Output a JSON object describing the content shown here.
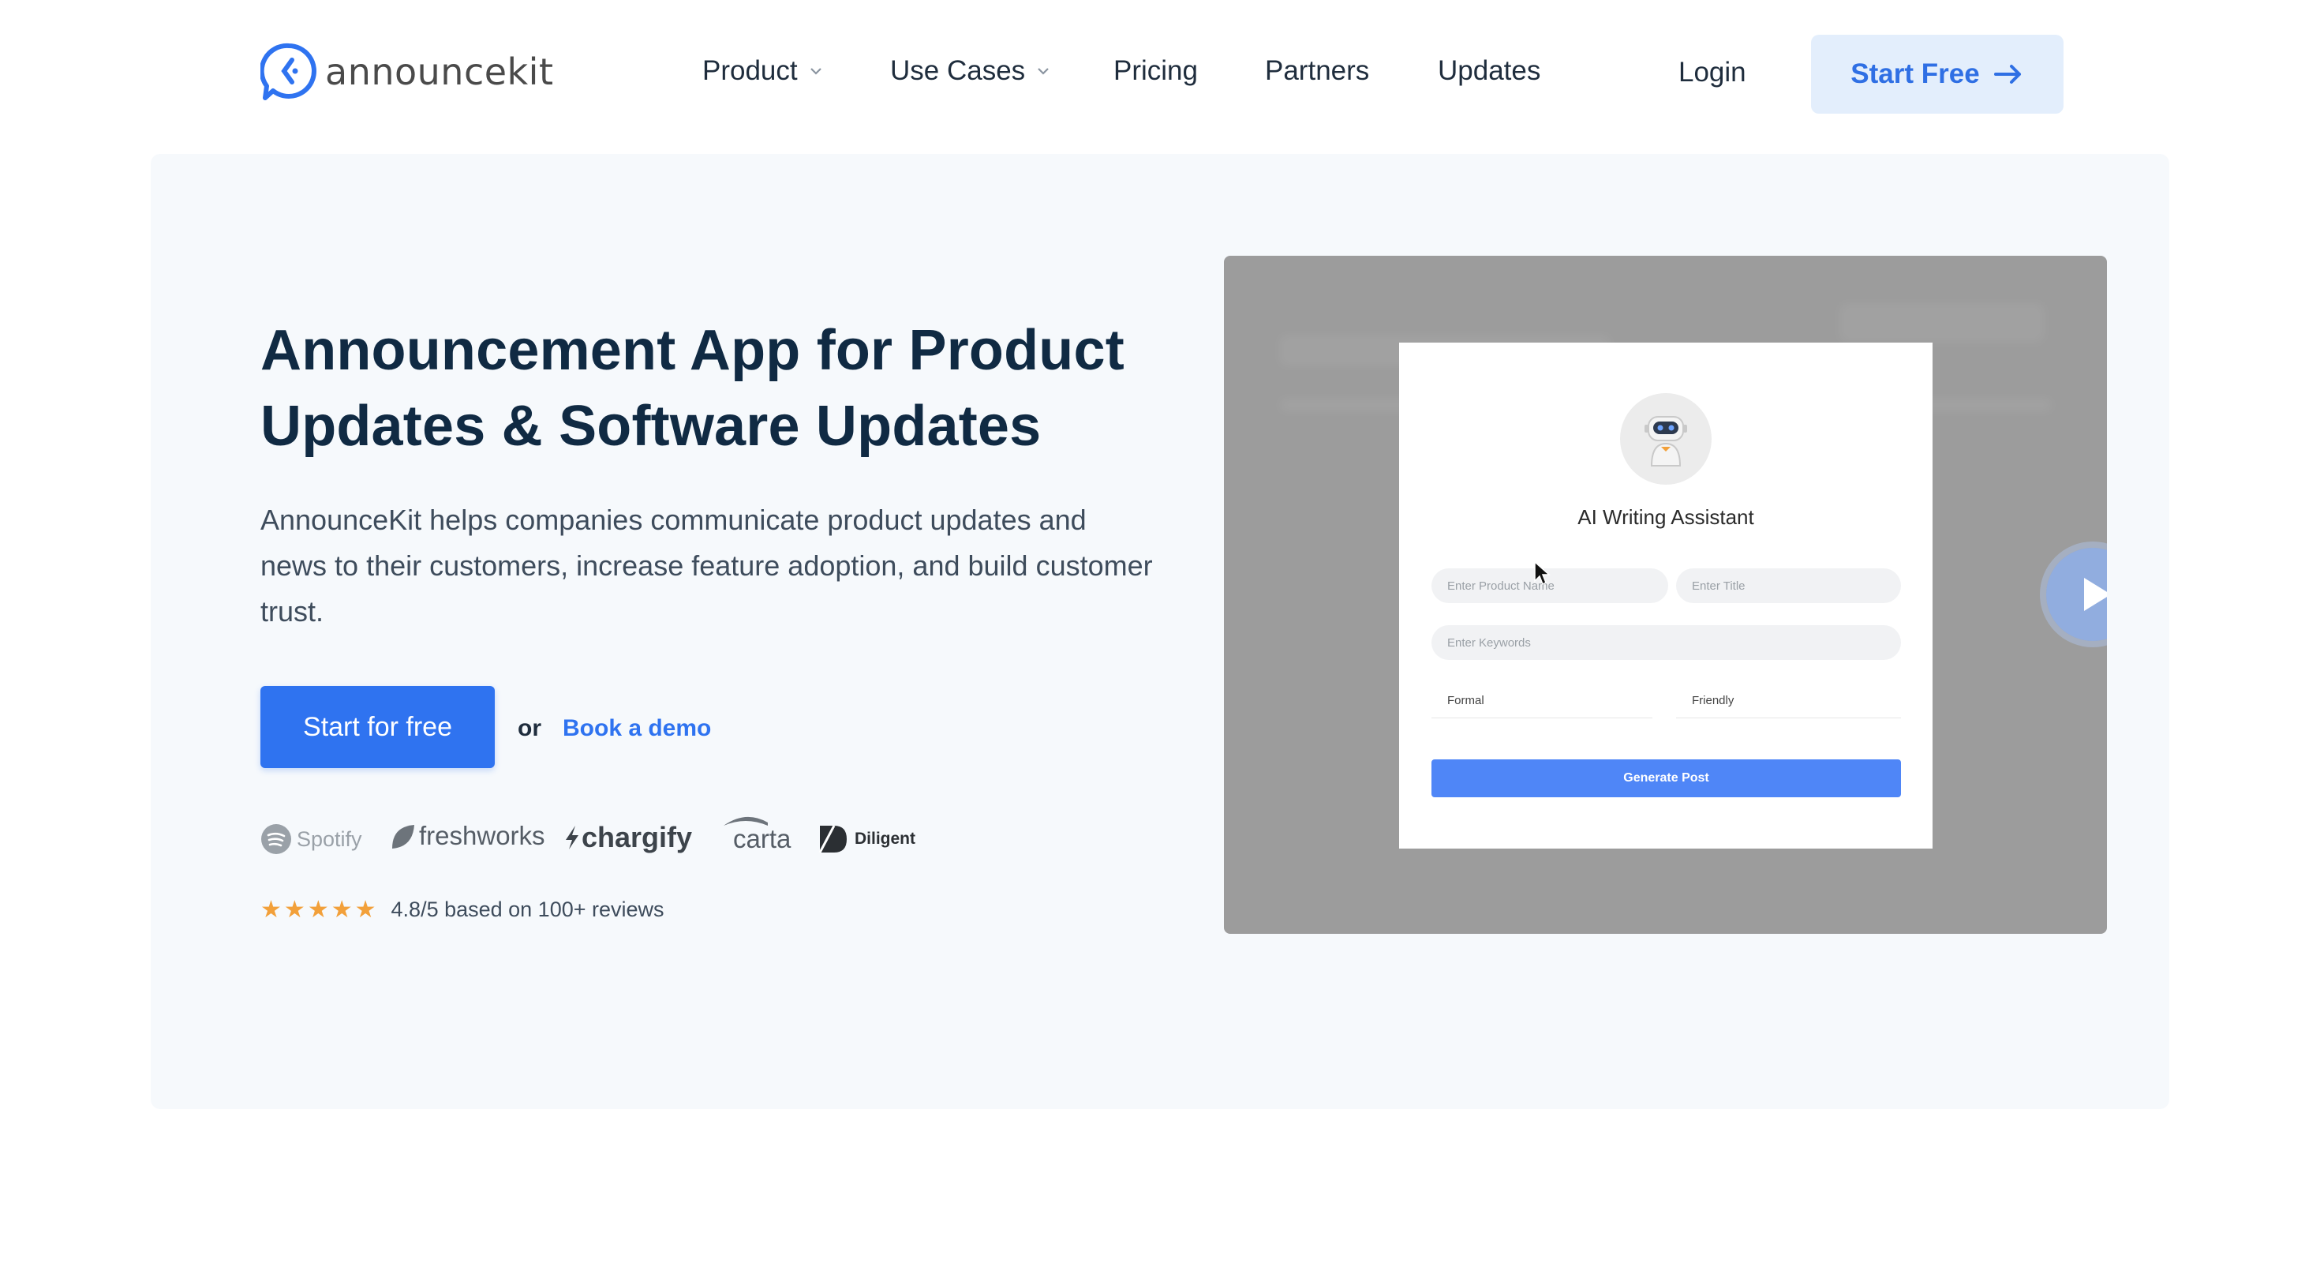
{
  "header": {
    "logo_text": "announcekit",
    "nav": [
      {
        "label": "Product",
        "has_dropdown": true
      },
      {
        "label": "Use Cases",
        "has_dropdown": true
      },
      {
        "label": "Pricing",
        "has_dropdown": false
      },
      {
        "label": "Partners",
        "has_dropdown": false
      },
      {
        "label": "Updates",
        "has_dropdown": false
      }
    ],
    "login_label": "Login",
    "start_free_label": "Start Free"
  },
  "hero": {
    "headline_line1": "Announcement App for Product",
    "headline_line2": "Updates & Software Updates",
    "subtext": "AnnounceKit helps companies communicate product updates and news to their customers, increase feature adoption, and build customer trust.",
    "cta_primary": "Start for free",
    "cta_or": "or",
    "cta_secondary": "Book a demo",
    "customer_logos": [
      "Spotify",
      "freshworks",
      "chargify",
      "carta",
      "Diligent"
    ],
    "rating": {
      "stars": 5,
      "text": "4.8/5 based on 100+ reviews"
    }
  },
  "video_preview": {
    "card_title": "AI Writing Assistant",
    "product_name_placeholder": "Enter Product Name",
    "title_placeholder": "Enter Title",
    "keywords_placeholder": "Enter Keywords",
    "tone_option_1": "Formal",
    "tone_option_2": "Friendly",
    "generate_button": "Generate Post"
  },
  "colors": {
    "primary": "#2f73f0",
    "headline": "#102a43",
    "hero_bg": "#f6f9fc",
    "start_free_bg": "#e3eefc",
    "star": "#f2a03a"
  }
}
